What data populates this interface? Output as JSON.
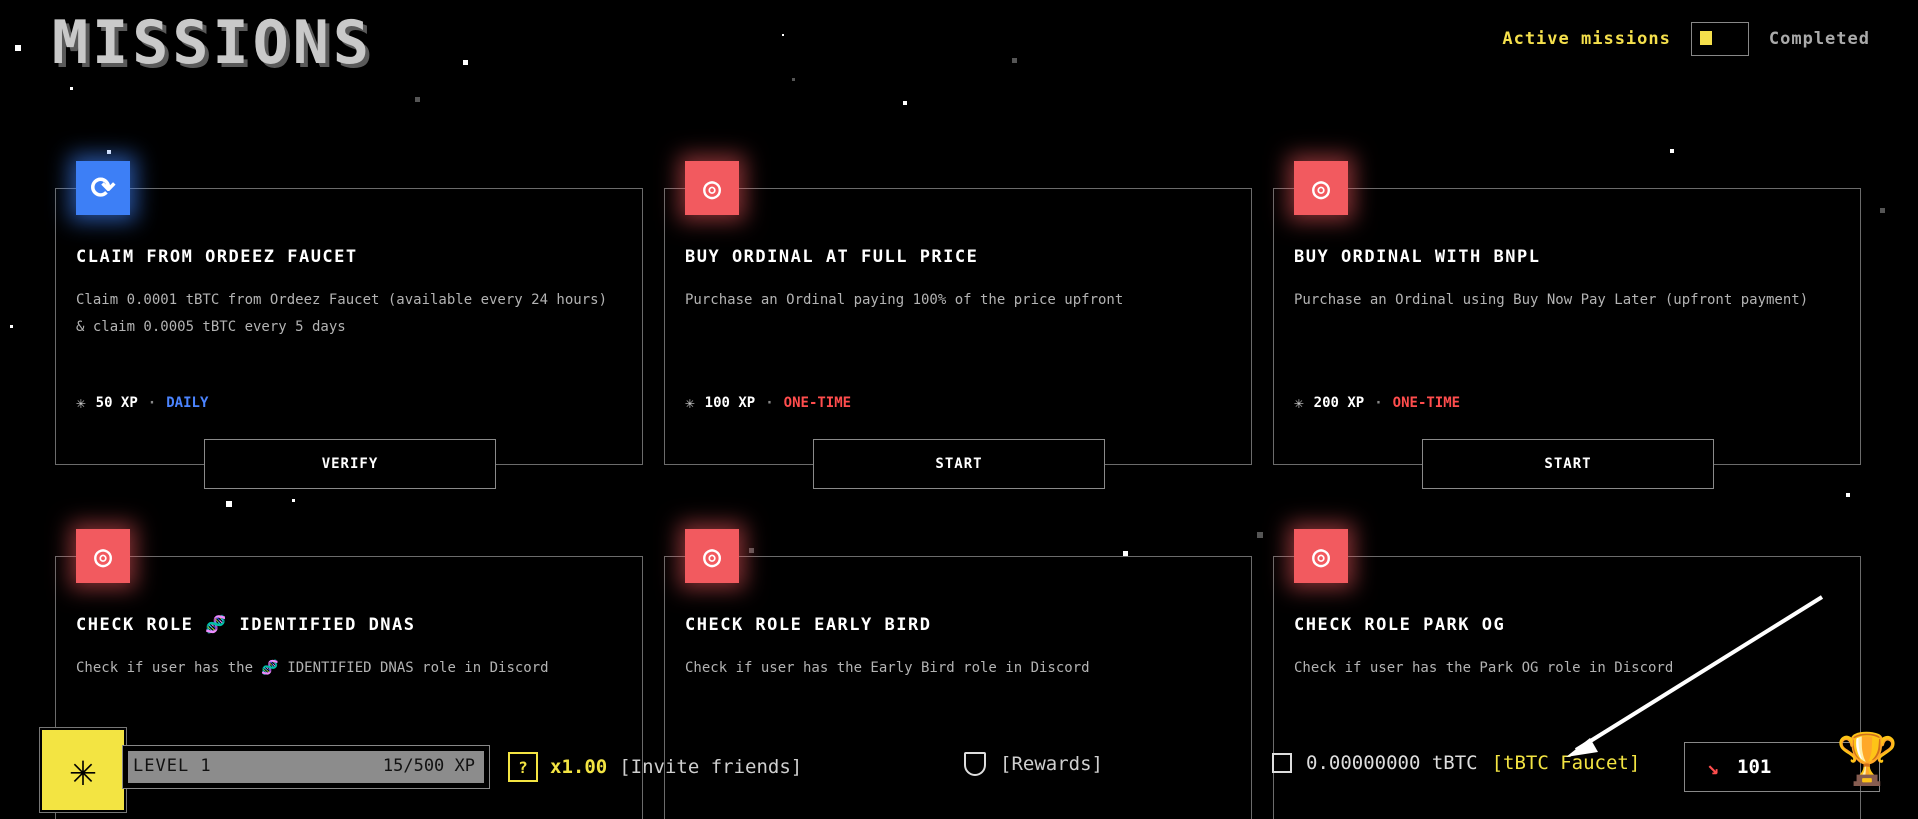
{
  "header": {
    "title": "MISSIONS",
    "toggle_active": "Active missions",
    "toggle_completed": "Completed"
  },
  "missions": [
    {
      "title": "CLAIM FROM ORDEEZ FAUCET",
      "desc": "Claim 0.0001 tBTC from Ordeez Faucet (available every 24 hours) & claim 0.0005 tBTC every 5 days",
      "xp": "50 XP",
      "frequency": "DAILY",
      "button": "VERIFY",
      "icon": "refresh-icon",
      "icon_color": "#3d7ff6"
    },
    {
      "title": "BUY ORDINAL AT FULL PRICE",
      "desc": "Purchase an Ordinal paying 100% of the price upfront",
      "xp": "100 XP",
      "frequency": "ONE-TIME",
      "button": "START",
      "icon": "target-icon",
      "icon_color": "#f25a5f"
    },
    {
      "title": "BUY ORDINAL WITH BNPL",
      "desc": "Purchase an Ordinal using Buy Now Pay Later (upfront payment)",
      "xp": "200 XP",
      "frequency": "ONE-TIME",
      "button": "START",
      "icon": "target-icon",
      "icon_color": "#f25a5f"
    },
    {
      "title": "CHECK ROLE 🧬 IDENTIFIED DNAS",
      "desc": "Check if user has the 🧬 IDENTIFIED DNAS role in Discord",
      "icon": "target-icon",
      "icon_color": "#f25a5f"
    },
    {
      "title": "CHECK ROLE EARLY BIRD",
      "desc": "Check if user has the Early Bird role in Discord",
      "icon": "target-icon",
      "icon_color": "#f25a5f"
    },
    {
      "title": "CHECK ROLE PARK OG",
      "desc": "Check if user has the Park OG role in Discord",
      "icon": "target-icon",
      "icon_color": "#f25a5f"
    }
  ],
  "footer": {
    "level": "LEVEL 1",
    "xp_progress": "15/500 XP",
    "multiplier": "x1.00",
    "invite": "[Invite friends]",
    "rewards": "[Rewards]",
    "balance": "0.00000000 tBTC",
    "faucet": "[tBTC Faucet]",
    "rank": "101"
  },
  "colors": {
    "accent": "#f3e442",
    "blue": "#3d7ff6",
    "red": "#f25a5f"
  }
}
